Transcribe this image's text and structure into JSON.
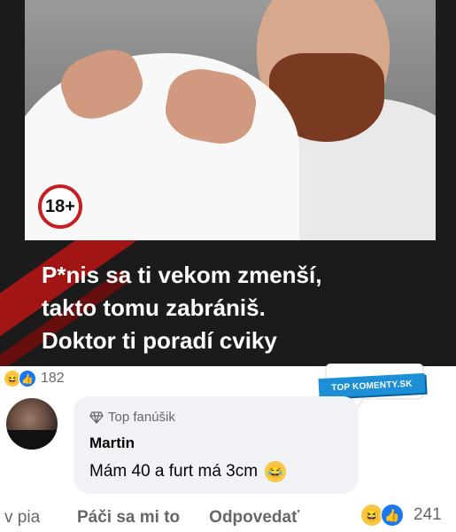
{
  "ad": {
    "badge": "18+",
    "headline_lines": [
      "P*nis sa ti vekom zmenší,",
      "takto tomu zabrániš.",
      "Doktor ti poradí cviky"
    ]
  },
  "post_reactions": {
    "count": "182",
    "icons": [
      "haha-emoji-icon",
      "like-icon"
    ]
  },
  "watermark": {
    "text": "TOP KOMENTY.SK"
  },
  "comment": {
    "badge": "Top fanúšik",
    "author": "Martin",
    "text": "Mám 40 a furt má 3cm",
    "emoji": "😂"
  },
  "actions": {
    "time": "v pia",
    "like_label": "Páči sa mi to",
    "reply_label": "Odpovedať",
    "reaction_count": "241"
  },
  "colors": {
    "brand_blue": "#1877f2",
    "haha_yellow": "#f7c844",
    "ad_red": "#c51f1f"
  }
}
